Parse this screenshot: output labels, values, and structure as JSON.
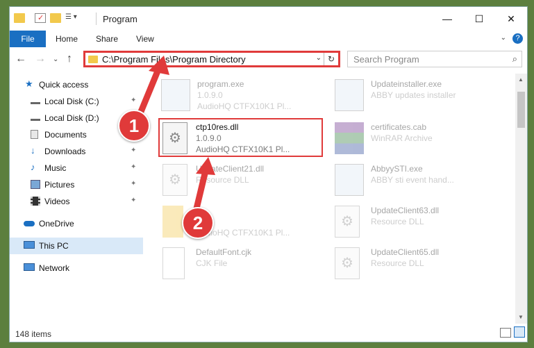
{
  "window": {
    "title": "Program",
    "minimize": "—",
    "maximize": "☐",
    "close": "✕"
  },
  "ribbon": {
    "file": "File",
    "tabs": [
      "Home",
      "Share",
      "View"
    ],
    "expand": "⌄",
    "help": "?"
  },
  "nav": {
    "back": "←",
    "forward": "→",
    "recent": "⌄",
    "up": "↑",
    "address": "C:\\Program Files\\Program Directory",
    "address_dropdown": "⌄",
    "refresh": "↻",
    "search_placeholder": "Search Program",
    "search_icon": "⌕"
  },
  "sidebar": {
    "items": [
      {
        "label": "Quick access",
        "icon": "star-icon"
      },
      {
        "label": "Local Disk (C:)",
        "icon": "drive-icon",
        "pinned": true
      },
      {
        "label": "Local Disk (D:)",
        "icon": "drive-icon",
        "pinned": true
      },
      {
        "label": "Documents",
        "icon": "documents-icon",
        "pinned": true
      },
      {
        "label": "Downloads",
        "icon": "download-icon",
        "pinned": true
      },
      {
        "label": "Music",
        "icon": "music-icon",
        "pinned": true
      },
      {
        "label": "Pictures",
        "icon": "pictures-icon",
        "pinned": true
      },
      {
        "label": "Videos",
        "icon": "video-icon",
        "pinned": true
      },
      {
        "label": "OneDrive",
        "icon": "cloud-icon"
      },
      {
        "label": "This PC",
        "icon": "computer-icon",
        "selected": true
      },
      {
        "label": "Network",
        "icon": "network-icon"
      }
    ],
    "pin_glyph": "📌"
  },
  "files": [
    {
      "name": "program.exe",
      "line1": "1.0.9.0",
      "line2": "AudioHQ CTFX10K1 Pl...",
      "icon": "exe-icon",
      "faded": true
    },
    {
      "name": "ctp10res.dll",
      "line1": "1.0.9.0",
      "line2": "AudioHQ CTFX10K1 Pl...",
      "icon": "dll-gear-icon",
      "faded": false
    },
    {
      "name": "UpdateClient21.dll",
      "line1": "Resource DLL",
      "line2": "",
      "icon": "dll-gear-icon",
      "faded": true
    },
    {
      "name": "",
      "line1": "0",
      "line2": "AudioHQ CTFX10K1 Pl...",
      "icon": "file-icon",
      "faded": true
    },
    {
      "name": "DefaultFont.cjk",
      "line1": "CJK File",
      "line2": "",
      "icon": "file-icon",
      "faded": true
    },
    {
      "name": "Updateinstaller.exe",
      "line1": "ABBY updates installer",
      "line2": "",
      "icon": "exe-icon",
      "faded": true
    },
    {
      "name": "certificates.cab",
      "line1": "WinRAR Archive",
      "line2": "",
      "icon": "archive-icon",
      "faded": true
    },
    {
      "name": "AbbyySTI.exe",
      "line1": "ABBY sti event hand...",
      "line2": "",
      "icon": "exe-icon",
      "faded": true
    },
    {
      "name": "UpdateClient63.dll",
      "line1": "Resource DLL",
      "line2": "",
      "icon": "dll-gear-icon",
      "faded": true
    },
    {
      "name": "UpdateClient65.dll",
      "line1": "Resource DLL",
      "line2": "",
      "icon": "dll-gear-icon",
      "faded": true
    }
  ],
  "status": {
    "items": "148 items"
  },
  "annotations": {
    "step1": "1",
    "step2": "2",
    "color": "#e03a3a"
  },
  "colors": {
    "accent": "#1a6fc2",
    "highlight": "#e03a3a"
  }
}
